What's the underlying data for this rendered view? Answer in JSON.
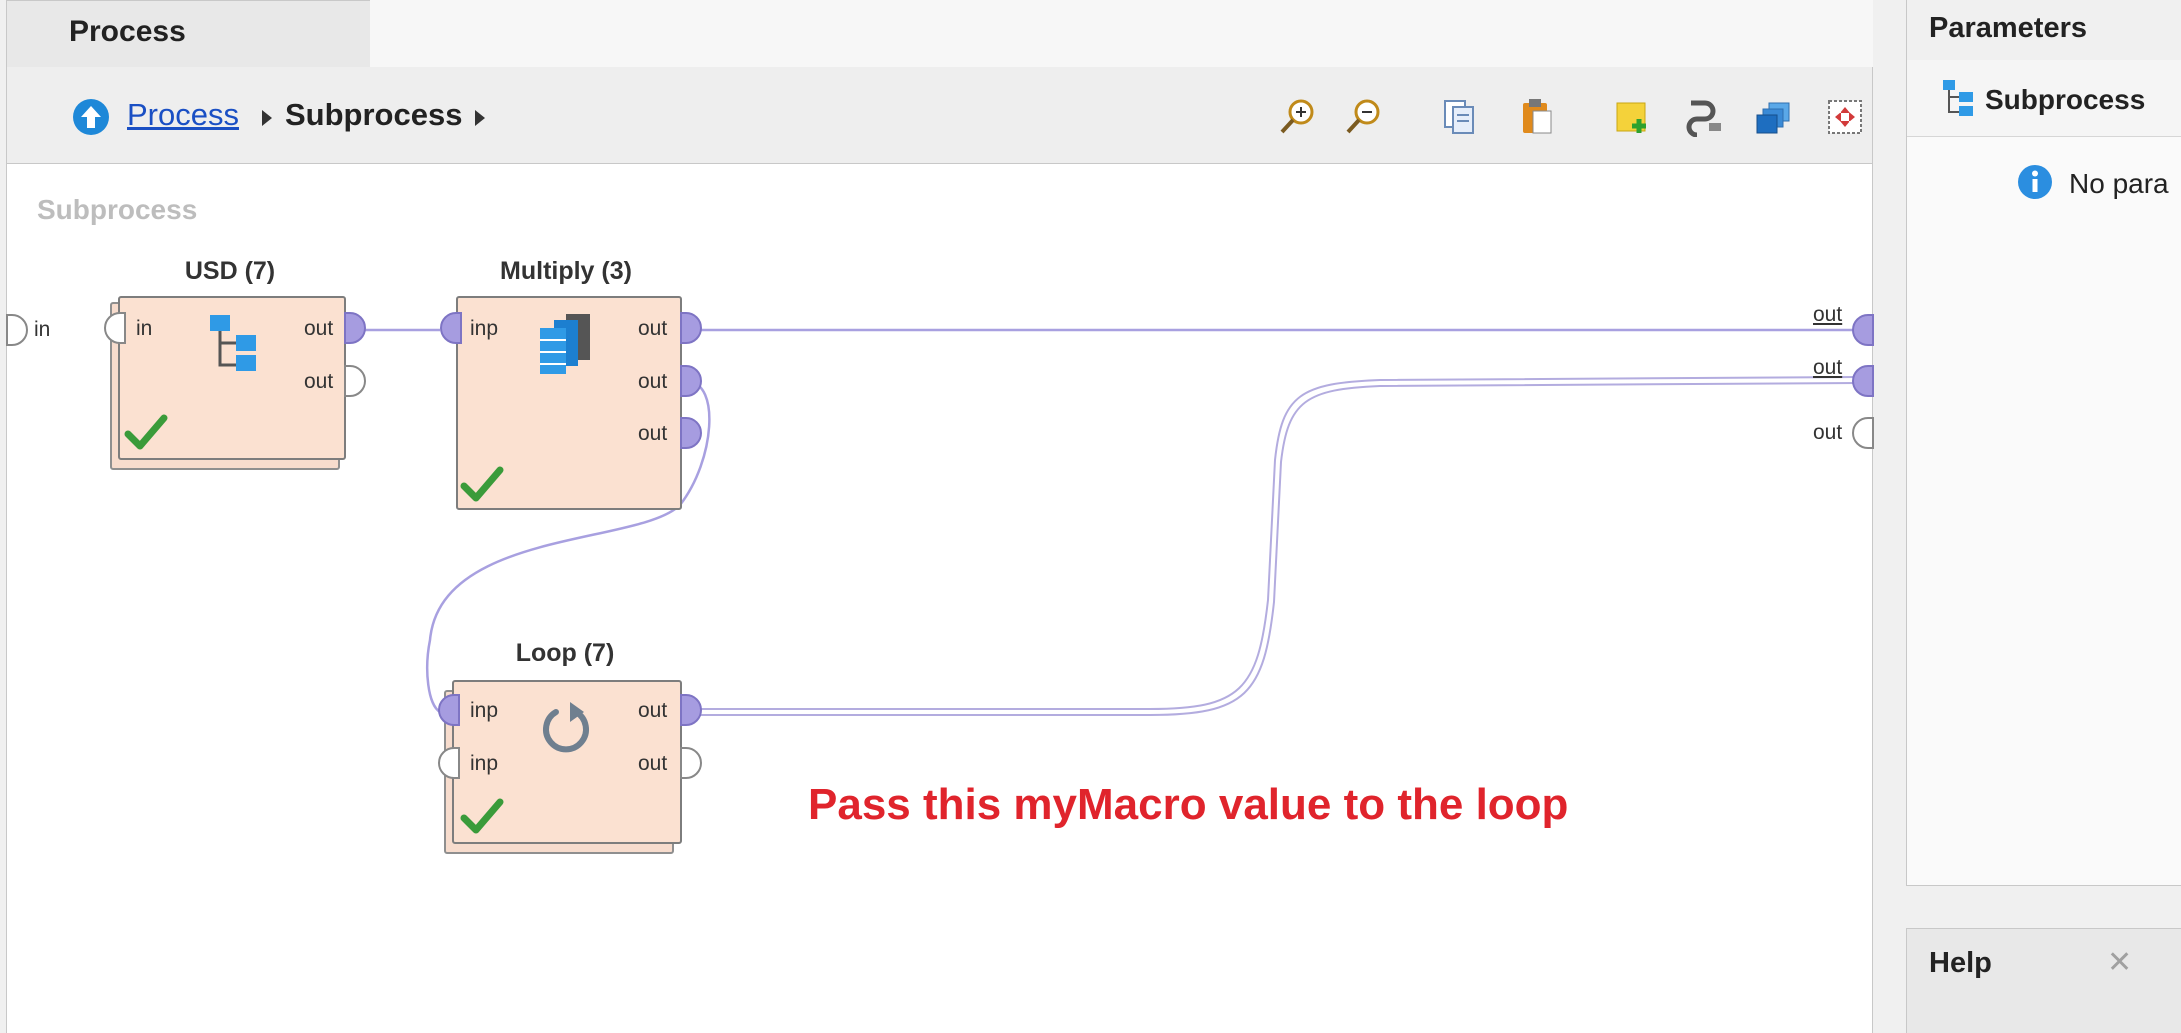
{
  "process_tab": {
    "label": "Process"
  },
  "breadcrumb": {
    "link": "Process",
    "current": "Subprocess"
  },
  "toolbar": {
    "icons": [
      "zoom-in-icon",
      "zoom-out-icon",
      "copy-icon",
      "paste-icon",
      "add-note-icon",
      "auto-wire-icon",
      "arrange-icon",
      "fit-icon"
    ]
  },
  "canvas": {
    "label": "Subprocess",
    "input_port": "in",
    "output_ports": [
      "out",
      "out",
      "out"
    ],
    "annotation": "Pass this myMacro value to the loop",
    "wire_color": "#a8a0e0"
  },
  "operators": {
    "usd": {
      "title": "USD (7)",
      "in": "in",
      "out1": "out",
      "out2": "out"
    },
    "multiply": {
      "title": "Multiply (3)",
      "in": "inp",
      "out1": "out",
      "out2": "out",
      "out3": "out"
    },
    "loop": {
      "title": "Loop (7)",
      "in1": "inp",
      "in2": "inp",
      "out1": "out",
      "out2": "out"
    }
  },
  "parameters": {
    "header": "Parameters",
    "operator": "Subprocess",
    "message": "No para"
  },
  "help": {
    "header": "Help",
    "close": "✕"
  },
  "colors": {
    "operator_fill": "#fbe1d1",
    "port_fill": "#a69ce0",
    "annotation": "#e0242c",
    "check": "#3a9b3a"
  }
}
